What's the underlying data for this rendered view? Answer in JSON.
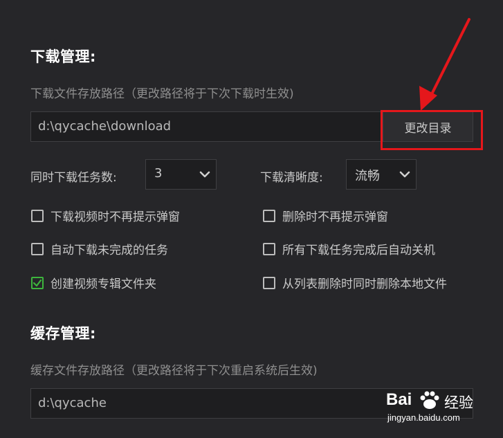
{
  "download": {
    "title": "下载管理:",
    "path_hint": "下载文件存放路径（更改路径将于下次下载时生效)",
    "path_value": "d:\\qycache\\download",
    "change_dir_label": "更改目录",
    "concurrent_label": "同时下载任务数:",
    "concurrent_value": "3",
    "quality_label": "下载清晰度:",
    "quality_value": "流畅",
    "options": [
      {
        "label": "下载视频时不再提示弹窗",
        "checked": false
      },
      {
        "label": "删除时不再提示弹窗",
        "checked": false
      },
      {
        "label": "自动下载未完成的任务",
        "checked": false
      },
      {
        "label": "所有下载任务完成后自动关机",
        "checked": false
      },
      {
        "label": "创建视频专辑文件夹",
        "checked": true
      },
      {
        "label": "从列表删除时同时删除本地文件",
        "checked": false
      }
    ]
  },
  "cache": {
    "title": "缓存管理:",
    "path_hint": "缓存文件存放路径（更改路径将于下次重启系统后生效)",
    "path_value": "d:\\qycache"
  },
  "watermark": {
    "brand": "Bai",
    "brand_suffix": "经验",
    "url": "jingyan.baidu.com"
  },
  "colors": {
    "annotation_red": "#e5171b",
    "checkbox_green": "#3db53d",
    "background": "#262629"
  }
}
